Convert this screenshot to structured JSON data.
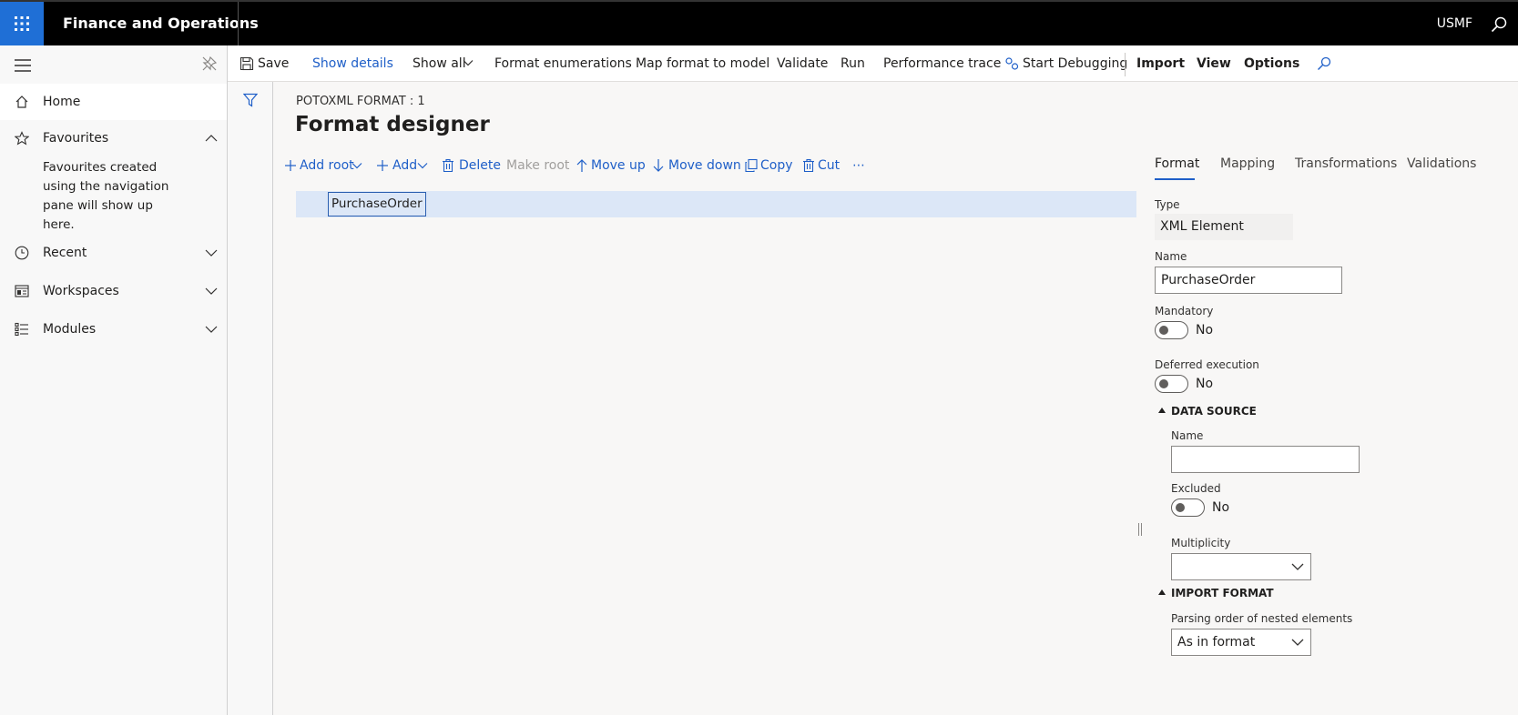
{
  "topbar": {
    "app_title": "Finance and Operations",
    "company": "USMF"
  },
  "sidebar": {
    "items": [
      {
        "label": "Home"
      },
      {
        "label": "Favourites"
      },
      {
        "label": "Recent"
      },
      {
        "label": "Workspaces"
      },
      {
        "label": "Modules"
      }
    ],
    "favourites_note": "Favourites created using the navigation pane will show up here."
  },
  "actionpane": {
    "save": "Save",
    "show_details": "Show details",
    "show_all": "Show all",
    "format_enumerations": "Format enumerations",
    "map_format_to_model": "Map format to model",
    "validate": "Validate",
    "run": "Run",
    "performance_trace": "Performance trace",
    "start_debugging": "Start Debugging",
    "import": "Import",
    "view": "View",
    "options": "Options"
  },
  "main": {
    "breadcrumb": "POTOXML FORMAT : 1",
    "title": "Format designer",
    "toolbar": {
      "add_root": "Add root",
      "add": "Add",
      "delete": "Delete",
      "make_root": "Make root",
      "move_up": "Move up",
      "move_down": "Move down",
      "copy": "Copy",
      "cut": "Cut",
      "more": "⋯"
    },
    "tree": {
      "selected_node": "PurchaseOrder"
    }
  },
  "details": {
    "tabs": [
      "Format",
      "Mapping",
      "Transformations",
      "Validations"
    ],
    "active_tab": "Format",
    "type_label": "Type",
    "type_value": "XML Element",
    "name_label": "Name",
    "name_value": "PurchaseOrder",
    "mandatory_label": "Mandatory",
    "mandatory_value": "No",
    "deferred_label": "Deferred execution",
    "deferred_value": "No",
    "data_source": {
      "header": "DATA SOURCE",
      "name_label": "Name",
      "name_value": "",
      "excluded_label": "Excluded",
      "excluded_value": "No",
      "multiplicity_label": "Multiplicity",
      "multiplicity_value": ""
    },
    "import_format": {
      "header": "IMPORT FORMAT",
      "parsing_label": "Parsing order of nested elements",
      "parsing_value": "As in format"
    }
  },
  "colors": {
    "accent": "#1f5fc8",
    "topbar": "#000000",
    "waffle": "#1f6fd6",
    "selected_row": "#dce7f7"
  }
}
